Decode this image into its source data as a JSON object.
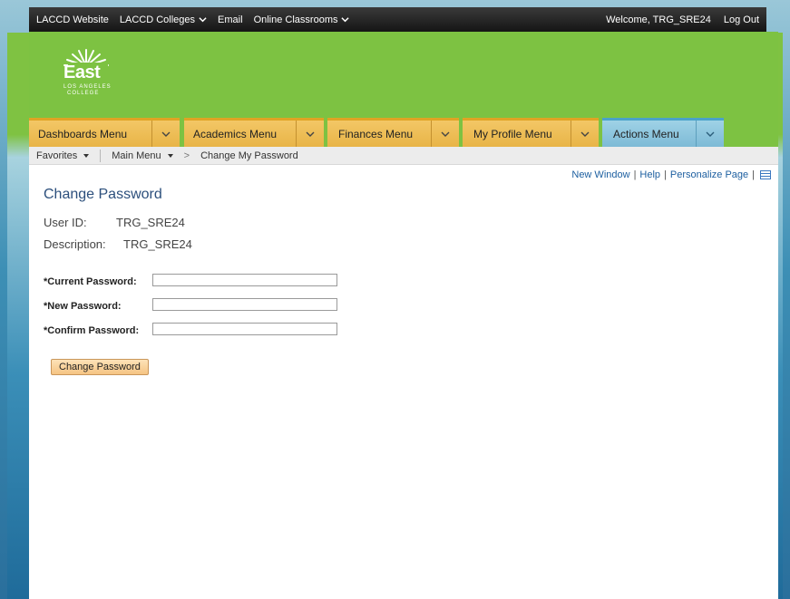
{
  "topbar": {
    "links": [
      {
        "label": "LACCD Website",
        "dropdown": false
      },
      {
        "label": "LACCD Colleges",
        "dropdown": true
      },
      {
        "label": "Email",
        "dropdown": false
      },
      {
        "label": "Online Classrooms",
        "dropdown": true
      }
    ],
    "welcome": "Welcome, TRG_SRE24",
    "logout": "Log Out"
  },
  "logo": {
    "name": "East",
    "sub_line1": "LOS ANGELES",
    "sub_line2": "COLLEGE"
  },
  "nav": {
    "tabs": [
      {
        "label": "Dashboards Menu",
        "active": false
      },
      {
        "label": "Academics Menu",
        "active": false
      },
      {
        "label": "Finances Menu",
        "active": false
      },
      {
        "label": "My Profile Menu",
        "active": false
      },
      {
        "label": "Actions Menu",
        "active": true
      }
    ]
  },
  "breadcrumb": {
    "favorites": "Favorites",
    "main_menu": "Main Menu",
    "current": "Change My Password"
  },
  "page_links": {
    "new_window": "New Window",
    "help": "Help",
    "personalize": "Personalize Page"
  },
  "page": {
    "title": "Change Password",
    "user_id_label": "User ID:",
    "user_id_value": "TRG_SRE24",
    "description_label": "Description:",
    "description_value": "TRG_SRE24"
  },
  "form": {
    "current_password_label": "*Current Password:",
    "new_password_label": "*New Password:",
    "confirm_password_label": "*Confirm Password:",
    "current_password_value": "",
    "new_password_value": "",
    "confirm_password_value": "",
    "submit_label": "Change Password"
  },
  "colors": {
    "header_green": "#7dc242",
    "tab_gold": "#e8b447",
    "tab_active_blue": "#7dbad6",
    "title_blue": "#2c4f7c",
    "link_blue": "#1d5fa0"
  }
}
